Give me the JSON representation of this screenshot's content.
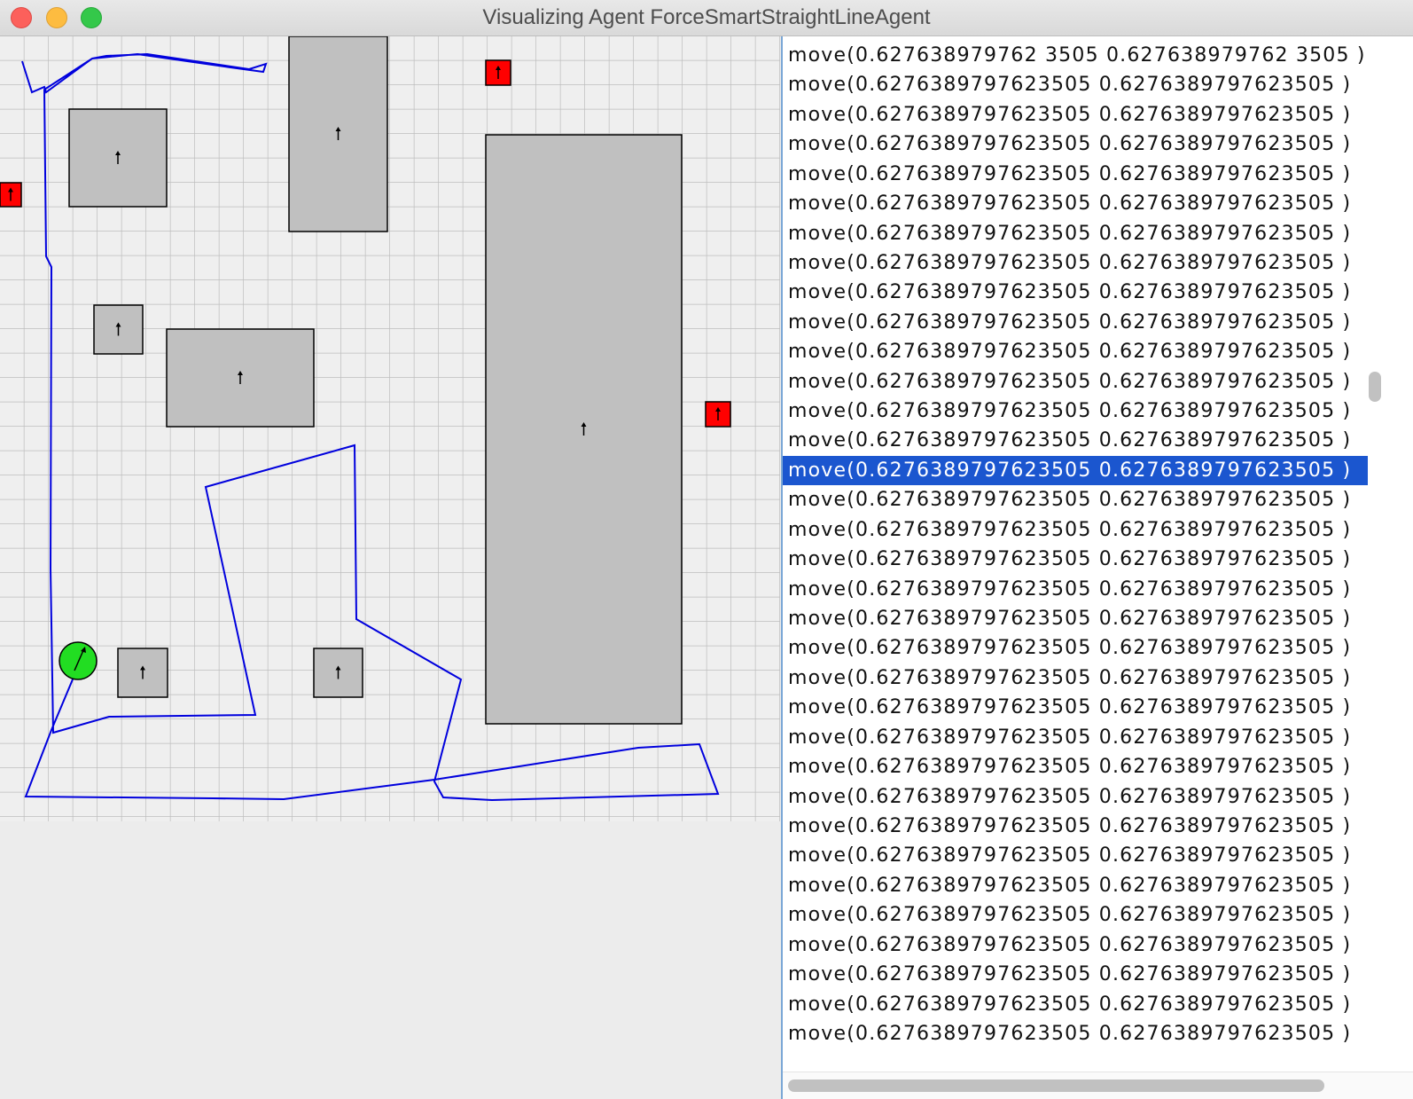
{
  "window": {
    "title": "Visualizing Agent ForceSmartStraightLineAgent"
  },
  "colors": {
    "grid_line": "#bdbdbd",
    "obstacle_fill": "#c0c0c0",
    "target_fill": "#ff0000",
    "agent_fill": "#22dd22",
    "path_stroke": "#0000dd",
    "selection": "#1b56cf"
  },
  "world": {
    "obstacles": [
      "obstacle",
      "obstacle",
      "obstacle",
      "obstacle",
      "obstacle",
      "obstacle",
      "obstacle",
      "obstacle"
    ],
    "targets": [
      "target",
      "target",
      "target"
    ],
    "agent": "agent"
  },
  "log": {
    "selected_index": 14,
    "entries": [
      "move(0.627638979762 3505 0.627638979762 3505 )",
      "move(0.6276389797623505 0.6276389797623505 )",
      "move(0.6276389797623505 0.6276389797623505 )",
      "move(0.6276389797623505 0.6276389797623505 )",
      "move(0.6276389797623505 0.6276389797623505 )",
      "move(0.6276389797623505 0.6276389797623505 )",
      "move(0.6276389797623505 0.6276389797623505 )",
      "move(0.6276389797623505 0.6276389797623505 )",
      "move(0.6276389797623505 0.6276389797623505 )",
      "move(0.6276389797623505 0.6276389797623505 )",
      "move(0.6276389797623505 0.6276389797623505 )",
      "move(0.6276389797623505 0.6276389797623505 )",
      "move(0.6276389797623505 0.6276389797623505 )",
      "move(0.6276389797623505 0.6276389797623505 )",
      "move(0.6276389797623505 0.6276389797623505 )",
      "move(0.6276389797623505 0.6276389797623505 )",
      "move(0.6276389797623505 0.6276389797623505 )",
      "move(0.6276389797623505 0.6276389797623505 )",
      "move(0.6276389797623505 0.6276389797623505 )",
      "move(0.6276389797623505 0.6276389797623505 )",
      "move(0.6276389797623505 0.6276389797623505 )",
      "move(0.6276389797623505 0.6276389797623505 )",
      "move(0.6276389797623505 0.6276389797623505 )",
      "move(0.6276389797623505 0.6276389797623505 )",
      "move(0.6276389797623505 0.6276389797623505 )",
      "move(0.6276389797623505 0.6276389797623505 )",
      "move(0.6276389797623505 0.6276389797623505 )",
      "move(0.6276389797623505 0.6276389797623505 )",
      "move(0.6276389797623505 0.6276389797623505 )",
      "move(0.6276389797623505 0.6276389797623505 )",
      "move(0.6276389797623505 0.6276389797623505 )",
      "move(0.6276389797623505 0.6276389797623505 )",
      "move(0.6276389797623505 0.6276389797623505 )",
      "move(0.6276389797623505 0.6276389797623505 )"
    ]
  }
}
